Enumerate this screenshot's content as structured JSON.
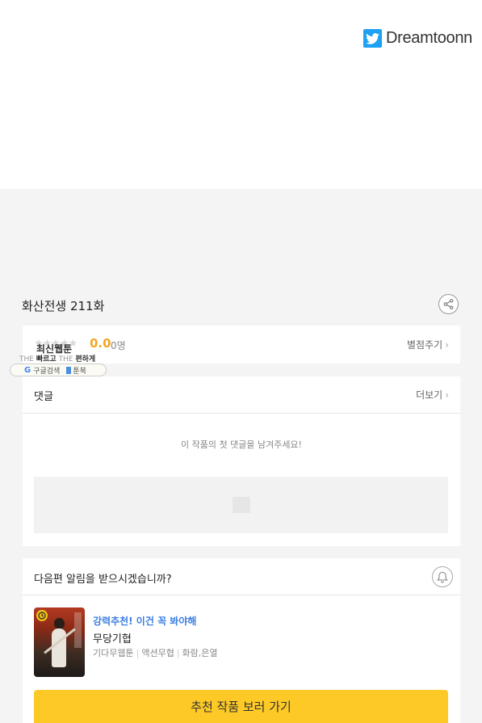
{
  "brand": {
    "name": "Dreamtoonn",
    "icon": "twitter-icon",
    "color": "#1da1f2"
  },
  "episode": {
    "title": "화산전생 211화"
  },
  "rating": {
    "stars": "★★★★★",
    "score": "0.0",
    "count": "0명",
    "action_label": "별점주기",
    "score_color": "#f5a623"
  },
  "overlay_badge": {
    "title": "최신웹툰",
    "subtitle_prefix1": "THE",
    "subtitle_word1": "빠르고",
    "subtitle_prefix2": "THE",
    "subtitle_word2": "편하게",
    "link1": "구글검색",
    "link2": "툰북"
  },
  "comments": {
    "heading": "댓글",
    "more_label": "더보기",
    "empty_message": "이 작품의 첫 댓글을 남겨주세요!"
  },
  "notify": {
    "question": "다음편 알림을 받으시겠습니까?",
    "recommend_label": "강력추천! 이건 꼭 봐야해",
    "recommend_title": "무당기협",
    "meta": [
      "기다무웹툰",
      "액션무협",
      "화람,은열"
    ],
    "cta_label": "추천 작품 보러 가기",
    "cta_color": "#fcc927",
    "label_color": "#3d7ee0"
  }
}
